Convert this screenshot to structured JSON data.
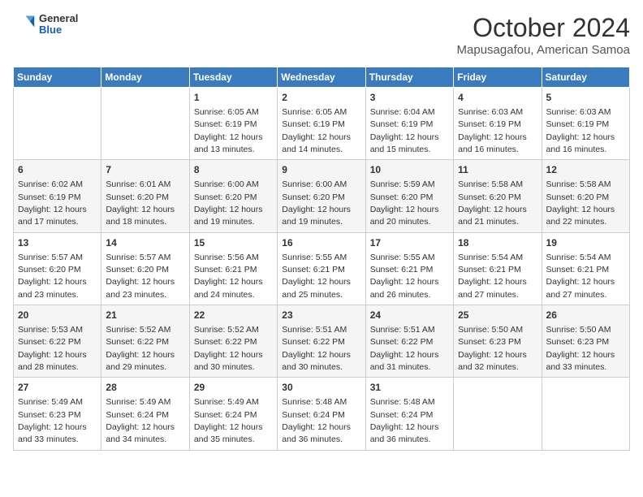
{
  "logo": {
    "general": "General",
    "blue": "Blue"
  },
  "header": {
    "month": "October 2024",
    "location": "Mapusagafou, American Samoa"
  },
  "weekdays": [
    "Sunday",
    "Monday",
    "Tuesday",
    "Wednesday",
    "Thursday",
    "Friday",
    "Saturday"
  ],
  "weeks": [
    [
      {
        "day": "",
        "info": ""
      },
      {
        "day": "",
        "info": ""
      },
      {
        "day": "1",
        "info": "Sunrise: 6:05 AM\nSunset: 6:19 PM\nDaylight: 12 hours and 13 minutes."
      },
      {
        "day": "2",
        "info": "Sunrise: 6:05 AM\nSunset: 6:19 PM\nDaylight: 12 hours and 14 minutes."
      },
      {
        "day": "3",
        "info": "Sunrise: 6:04 AM\nSunset: 6:19 PM\nDaylight: 12 hours and 15 minutes."
      },
      {
        "day": "4",
        "info": "Sunrise: 6:03 AM\nSunset: 6:19 PM\nDaylight: 12 hours and 16 minutes."
      },
      {
        "day": "5",
        "info": "Sunrise: 6:03 AM\nSunset: 6:19 PM\nDaylight: 12 hours and 16 minutes."
      }
    ],
    [
      {
        "day": "6",
        "info": "Sunrise: 6:02 AM\nSunset: 6:19 PM\nDaylight: 12 hours and 17 minutes."
      },
      {
        "day": "7",
        "info": "Sunrise: 6:01 AM\nSunset: 6:20 PM\nDaylight: 12 hours and 18 minutes."
      },
      {
        "day": "8",
        "info": "Sunrise: 6:00 AM\nSunset: 6:20 PM\nDaylight: 12 hours and 19 minutes."
      },
      {
        "day": "9",
        "info": "Sunrise: 6:00 AM\nSunset: 6:20 PM\nDaylight: 12 hours and 19 minutes."
      },
      {
        "day": "10",
        "info": "Sunrise: 5:59 AM\nSunset: 6:20 PM\nDaylight: 12 hours and 20 minutes."
      },
      {
        "day": "11",
        "info": "Sunrise: 5:58 AM\nSunset: 6:20 PM\nDaylight: 12 hours and 21 minutes."
      },
      {
        "day": "12",
        "info": "Sunrise: 5:58 AM\nSunset: 6:20 PM\nDaylight: 12 hours and 22 minutes."
      }
    ],
    [
      {
        "day": "13",
        "info": "Sunrise: 5:57 AM\nSunset: 6:20 PM\nDaylight: 12 hours and 23 minutes."
      },
      {
        "day": "14",
        "info": "Sunrise: 5:57 AM\nSunset: 6:20 PM\nDaylight: 12 hours and 23 minutes."
      },
      {
        "day": "15",
        "info": "Sunrise: 5:56 AM\nSunset: 6:21 PM\nDaylight: 12 hours and 24 minutes."
      },
      {
        "day": "16",
        "info": "Sunrise: 5:55 AM\nSunset: 6:21 PM\nDaylight: 12 hours and 25 minutes."
      },
      {
        "day": "17",
        "info": "Sunrise: 5:55 AM\nSunset: 6:21 PM\nDaylight: 12 hours and 26 minutes."
      },
      {
        "day": "18",
        "info": "Sunrise: 5:54 AM\nSunset: 6:21 PM\nDaylight: 12 hours and 27 minutes."
      },
      {
        "day": "19",
        "info": "Sunrise: 5:54 AM\nSunset: 6:21 PM\nDaylight: 12 hours and 27 minutes."
      }
    ],
    [
      {
        "day": "20",
        "info": "Sunrise: 5:53 AM\nSunset: 6:22 PM\nDaylight: 12 hours and 28 minutes."
      },
      {
        "day": "21",
        "info": "Sunrise: 5:52 AM\nSunset: 6:22 PM\nDaylight: 12 hours and 29 minutes."
      },
      {
        "day": "22",
        "info": "Sunrise: 5:52 AM\nSunset: 6:22 PM\nDaylight: 12 hours and 30 minutes."
      },
      {
        "day": "23",
        "info": "Sunrise: 5:51 AM\nSunset: 6:22 PM\nDaylight: 12 hours and 30 minutes."
      },
      {
        "day": "24",
        "info": "Sunrise: 5:51 AM\nSunset: 6:22 PM\nDaylight: 12 hours and 31 minutes."
      },
      {
        "day": "25",
        "info": "Sunrise: 5:50 AM\nSunset: 6:23 PM\nDaylight: 12 hours and 32 minutes."
      },
      {
        "day": "26",
        "info": "Sunrise: 5:50 AM\nSunset: 6:23 PM\nDaylight: 12 hours and 33 minutes."
      }
    ],
    [
      {
        "day": "27",
        "info": "Sunrise: 5:49 AM\nSunset: 6:23 PM\nDaylight: 12 hours and 33 minutes."
      },
      {
        "day": "28",
        "info": "Sunrise: 5:49 AM\nSunset: 6:24 PM\nDaylight: 12 hours and 34 minutes."
      },
      {
        "day": "29",
        "info": "Sunrise: 5:49 AM\nSunset: 6:24 PM\nDaylight: 12 hours and 35 minutes."
      },
      {
        "day": "30",
        "info": "Sunrise: 5:48 AM\nSunset: 6:24 PM\nDaylight: 12 hours and 36 minutes."
      },
      {
        "day": "31",
        "info": "Sunrise: 5:48 AM\nSunset: 6:24 PM\nDaylight: 12 hours and 36 minutes."
      },
      {
        "day": "",
        "info": ""
      },
      {
        "day": "",
        "info": ""
      }
    ]
  ]
}
